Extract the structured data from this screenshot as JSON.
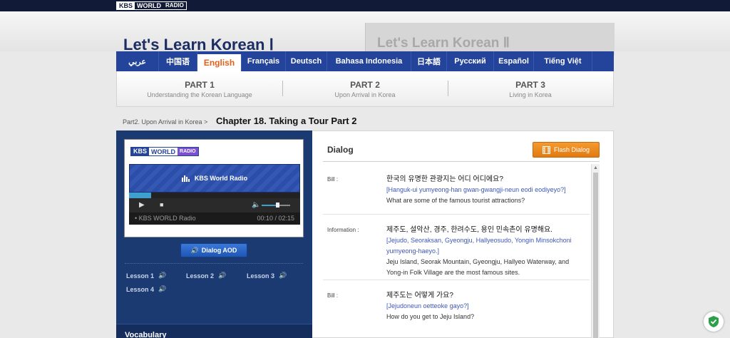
{
  "topbar": {
    "logo": {
      "k": "KBS",
      "w": "WORLD",
      "r": "RADIO"
    }
  },
  "header": {
    "title1": "Let's Learn Korean Ⅰ",
    "title2": "Let's Learn Korean Ⅱ"
  },
  "languages": [
    {
      "label": "عربي",
      "active": false
    },
    {
      "label": "中国语",
      "active": false
    },
    {
      "label": "English",
      "active": true
    },
    {
      "label": "Français",
      "active": false
    },
    {
      "label": "Deutsch",
      "active": false
    },
    {
      "label": "Bahasa Indonesia",
      "active": false
    },
    {
      "label": "日本語",
      "active": false
    },
    {
      "label": "Русский",
      "active": false
    },
    {
      "label": "Español",
      "active": false
    },
    {
      "label": "Tiếng Việt",
      "active": false
    }
  ],
  "parts": [
    {
      "name": "PART 1",
      "desc": "Understanding the Korean Language"
    },
    {
      "name": "PART 2",
      "desc": "Upon Arrival in Korea"
    },
    {
      "name": "PART 3",
      "desc": "Living in Korea"
    }
  ],
  "breadcrumb": "Part2. Upon Arrival in Korea >",
  "chapter": "Chapter 18. Taking a Tour Part 2",
  "player": {
    "logo": {
      "k": "KBS",
      "w": "WORLD",
      "r": "RADIO"
    },
    "banner": "KBS World Radio",
    "station": "• KBS WORLD Radio",
    "time": "00:10 / 02:15",
    "progress": 0.13,
    "volume": 0.5
  },
  "aod_button": "Dialog AOD",
  "lessons": [
    "Lesson 1",
    "Lesson 2",
    "Lesson 3",
    "Lesson 4"
  ],
  "vocabulary_label": "Vocabulary",
  "dialog": {
    "title": "Dialog",
    "flash_button": "Flash Dialog",
    "entries": [
      {
        "speaker": "Bill :",
        "korean": "한국의 유명한 관광지는 어디 어디에요?",
        "romanization": "[Hanguk-ui yumyeong-han gwan-gwangji-neun eodi eodiyeyo?]",
        "english": "What are some of the famous tourist attractions?"
      },
      {
        "speaker": "Information :",
        "korean": "제주도, 설악산, 경주, 한려수도, 용인 민속촌이 유명해요.",
        "romanization": "[Jejudo, Seoraksan, Gyeongju, Hallyeosudo, Yongin Minsokchoni yumyeong-haeyo.]",
        "english": "Jeju Island, Seorak Mountain, Gyeongju, Hallyeo Waterway, and Yong-in Folk Village are the most famous sites."
      },
      {
        "speaker": "Bill :",
        "korean": "제주도는 어떻게 가요?",
        "romanization": "[Jejudoneun oetteoke gayo?]",
        "english": "How do you get to Jeju Island?"
      }
    ]
  },
  "colors": {
    "navy": "#24439a",
    "accent": "#e4601a",
    "panel": "#1c3a72",
    "romanization": "#3d57b8"
  }
}
